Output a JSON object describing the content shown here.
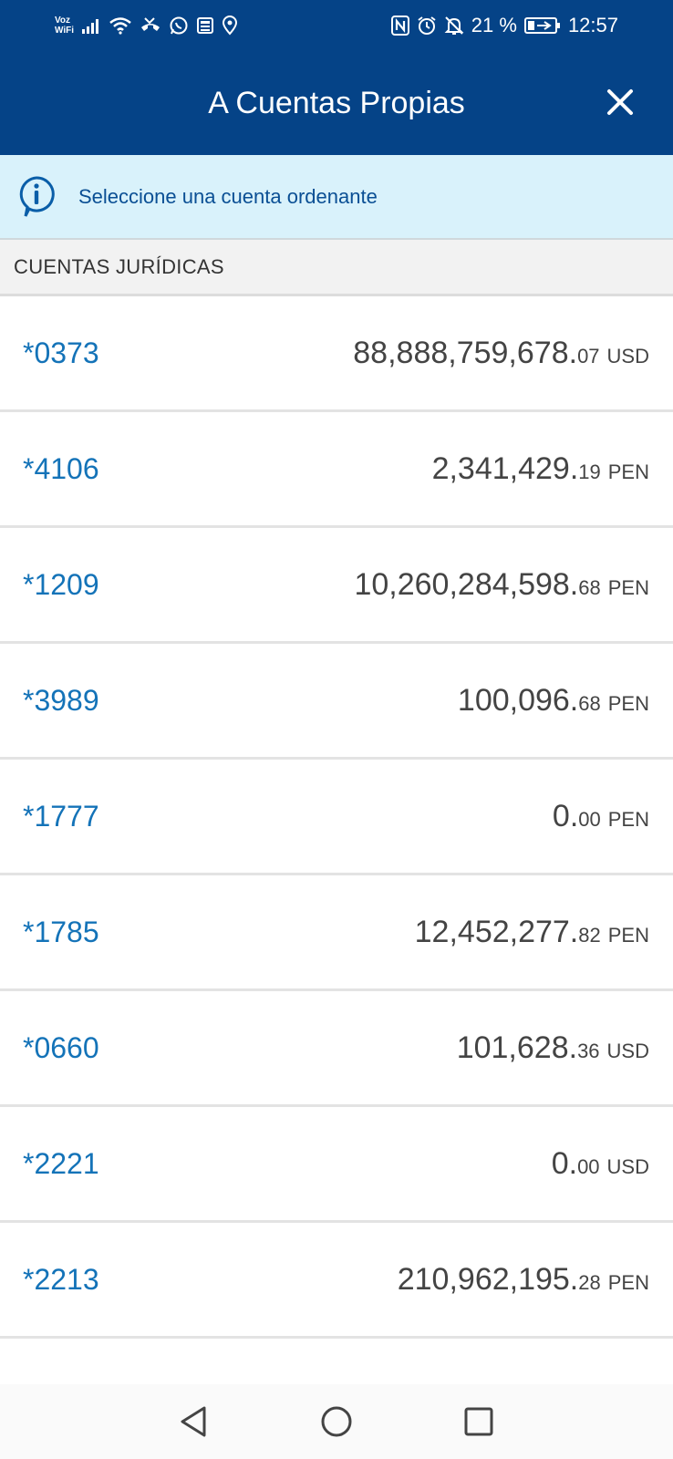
{
  "status_bar": {
    "voz_label": "Voz",
    "wifi_label": "WiFi",
    "battery": "21 %",
    "time": "12:57"
  },
  "header": {
    "title": "A Cuentas Propias"
  },
  "info_banner": {
    "text": "Seleccione una cuenta ordenante"
  },
  "section": {
    "title": "CUENTAS JURÍDICAS"
  },
  "accounts": [
    {
      "id": "*0373",
      "amount_int": "88,888,759,678.",
      "amount_dec": "07",
      "currency": "USD"
    },
    {
      "id": "*4106",
      "amount_int": "2,341,429.",
      "amount_dec": "19",
      "currency": "PEN"
    },
    {
      "id": "*1209",
      "amount_int": "10,260,284,598.",
      "amount_dec": "68",
      "currency": "PEN"
    },
    {
      "id": "*3989",
      "amount_int": "100,096.",
      "amount_dec": "68",
      "currency": "PEN"
    },
    {
      "id": "*1777",
      "amount_int": "0.",
      "amount_dec": "00",
      "currency": "PEN"
    },
    {
      "id": "*1785",
      "amount_int": "12,452,277.",
      "amount_dec": "82",
      "currency": "PEN"
    },
    {
      "id": "*0660",
      "amount_int": "101,628.",
      "amount_dec": "36",
      "currency": "USD"
    },
    {
      "id": "*2221",
      "amount_int": "0.",
      "amount_dec": "00",
      "currency": "USD"
    },
    {
      "id": "*2213",
      "amount_int": "210,962,195.",
      "amount_dec": "28",
      "currency": "PEN"
    }
  ],
  "colors": {
    "brand_blue": "#054387",
    "account_id_blue": "#1473b8",
    "info_bg": "#d9f2fb"
  },
  "icons": [
    "signal-icon",
    "wifi-icon",
    "missed-call-icon",
    "whatsapp-icon",
    "news-icon",
    "location-icon",
    "nfc-icon",
    "alarm-icon",
    "mute-icon",
    "battery-icon",
    "close-icon",
    "info-icon",
    "back-icon",
    "home-icon",
    "recents-icon"
  ]
}
